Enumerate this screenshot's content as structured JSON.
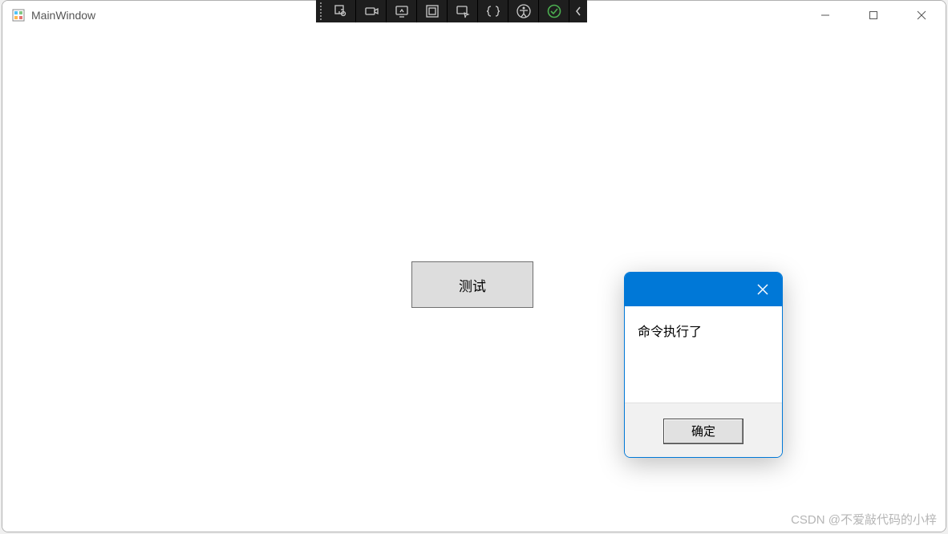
{
  "window": {
    "title": "MainWindow"
  },
  "debug_toolbar": {
    "icons": [
      "select-element",
      "camera",
      "screen-share",
      "layout-box",
      "screen-select",
      "code-braces",
      "accessibility",
      "checkmark-ok"
    ]
  },
  "main": {
    "test_button_label": "测试"
  },
  "messagebox": {
    "message": "命令执行了",
    "ok_label": "确定"
  },
  "watermark": "CSDN @不爱敲代码的小梓"
}
